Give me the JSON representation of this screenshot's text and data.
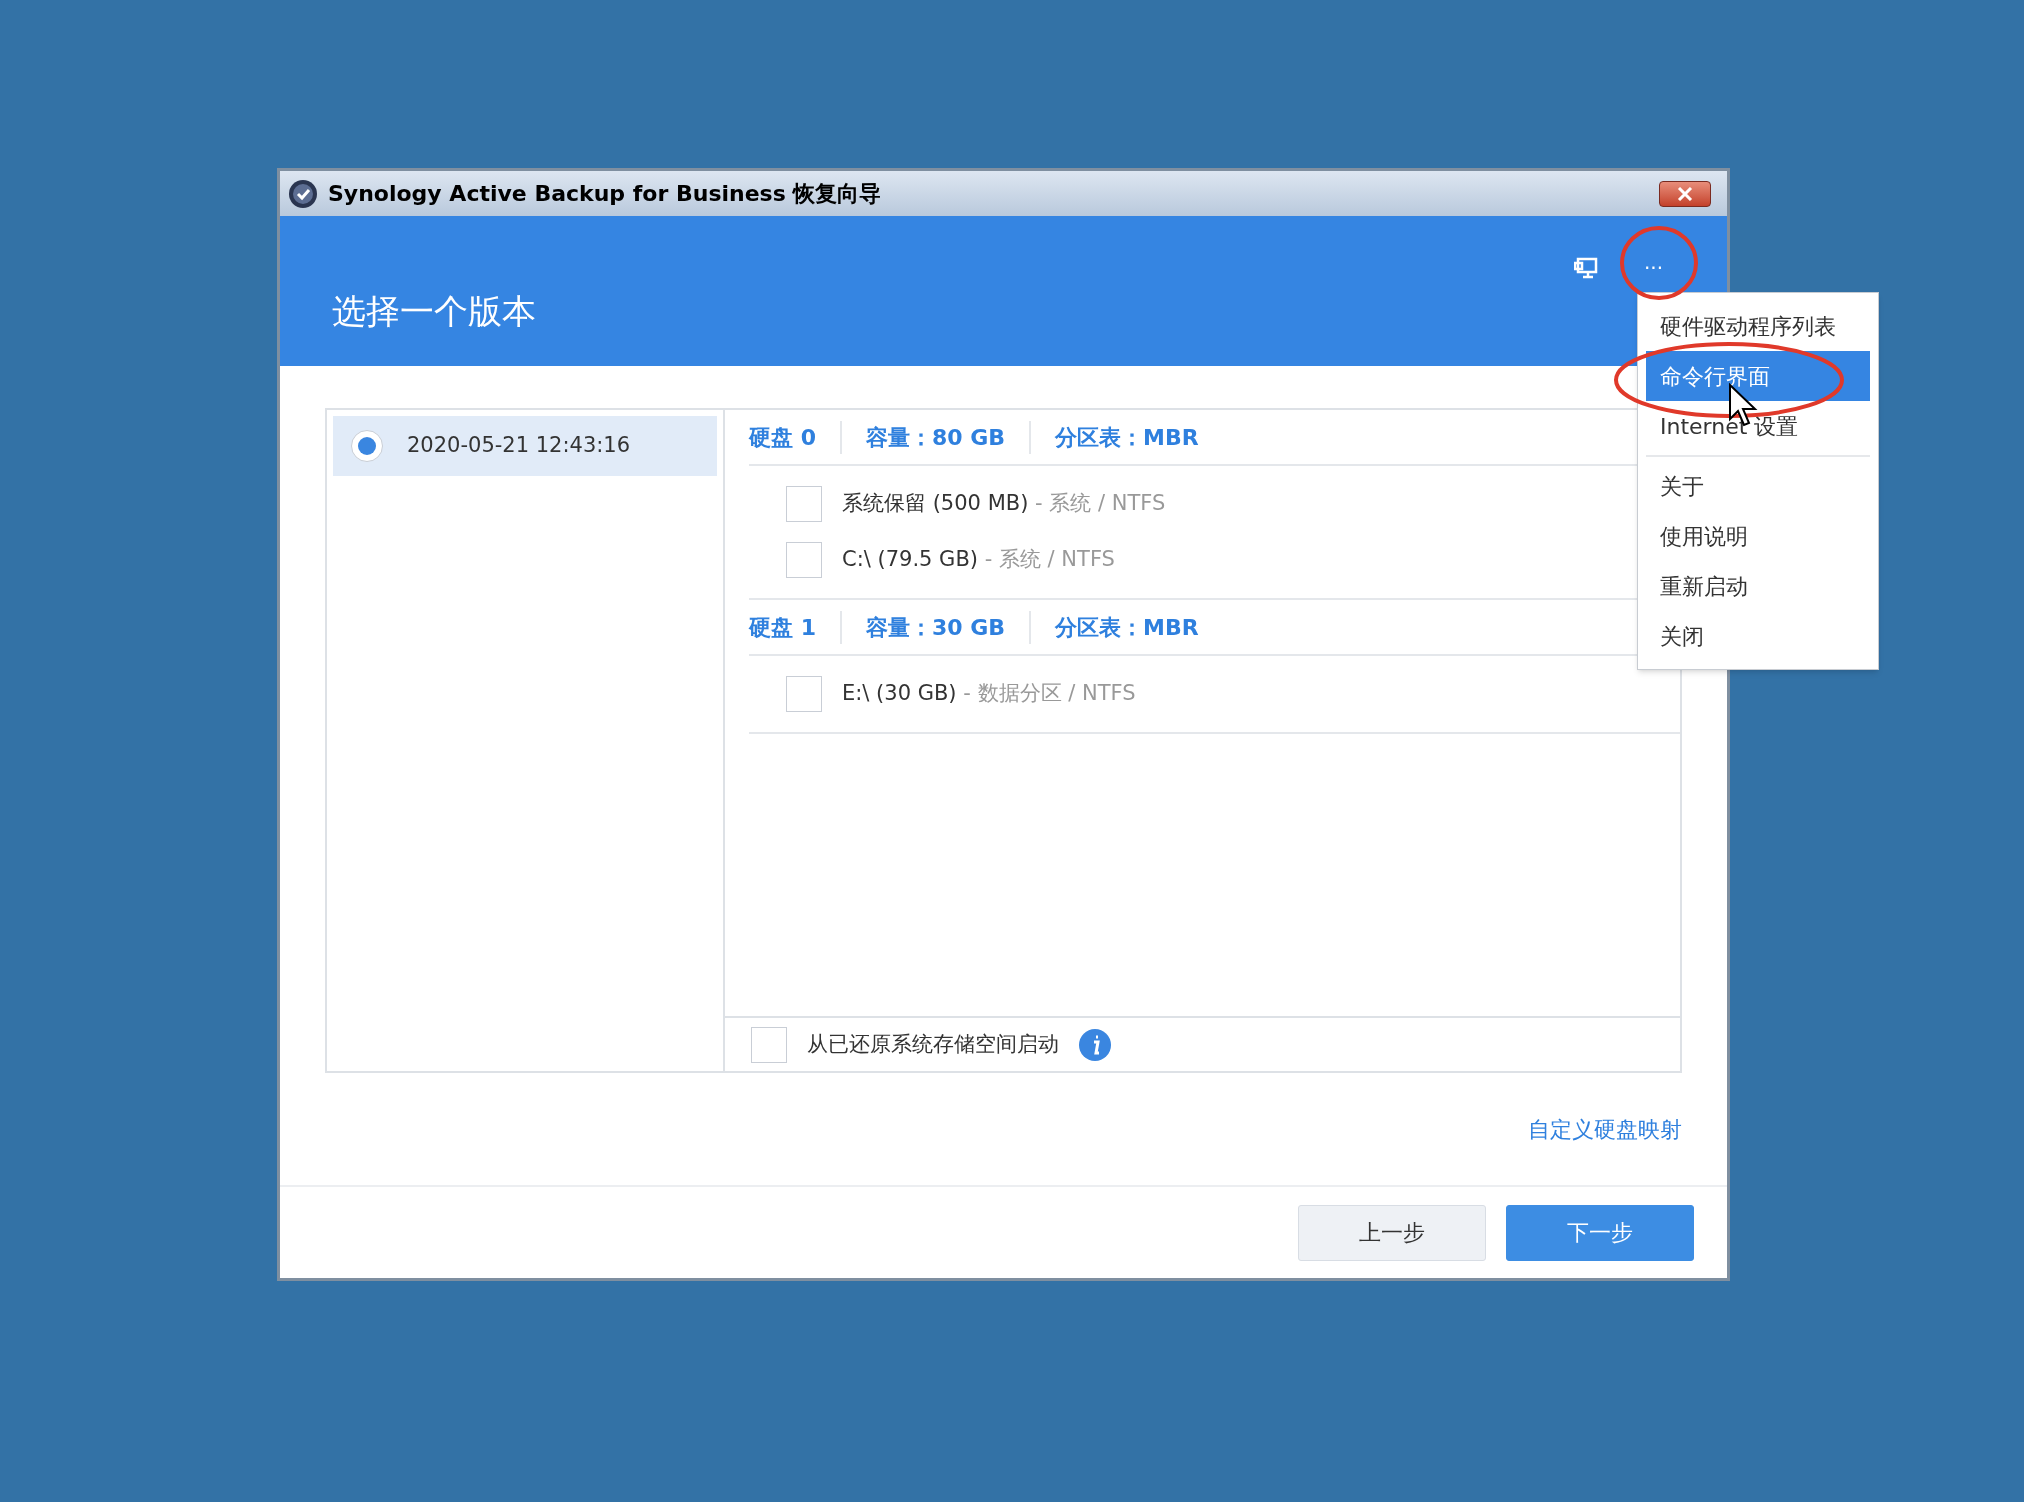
{
  "window": {
    "title": "Synology Active Backup for Business 恢复向导"
  },
  "header": {
    "title": "选择一个版本",
    "more_button": "···"
  },
  "menu": {
    "groups": [
      [
        {
          "label": "硬件驱动程序列表",
          "selected": false
        },
        {
          "label": "命令行界面",
          "selected": true
        },
        {
          "label": "Internet 设置",
          "selected": false
        }
      ],
      [
        {
          "label": "关于",
          "selected": false
        },
        {
          "label": "使用说明",
          "selected": false
        },
        {
          "label": "重新启动",
          "selected": false
        },
        {
          "label": "关闭",
          "selected": false
        }
      ]
    ]
  },
  "versions": [
    {
      "label": "2020-05-21 12:43:16",
      "selected": true
    }
  ],
  "disks": [
    {
      "name": "硬盘 0",
      "capacity": "容量：80 GB",
      "partition_table": "分区表：MBR",
      "partitions": [
        {
          "name": "系统保留 (500 MB)",
          "detail": "- 系统 / NTFS",
          "checked": false
        },
        {
          "name": "C:\\ (79.5 GB)",
          "detail": "- 系统 / NTFS",
          "checked": false
        }
      ]
    },
    {
      "name": "硬盘 1",
      "capacity": "容量：30 GB",
      "partition_table": "分区表：MBR",
      "partitions": [
        {
          "name": "E:\\ (30 GB)",
          "detail": "- 数据分区 / NTFS",
          "checked": false
        }
      ]
    }
  ],
  "boot_option": {
    "label": "从已还原系统存储空间启动",
    "checked": false
  },
  "link": "自定义硬盘映射",
  "buttons": [
    {
      "label": "上一步",
      "kind": "secondary"
    },
    {
      "label": "下一步",
      "kind": "primary"
    }
  ]
}
